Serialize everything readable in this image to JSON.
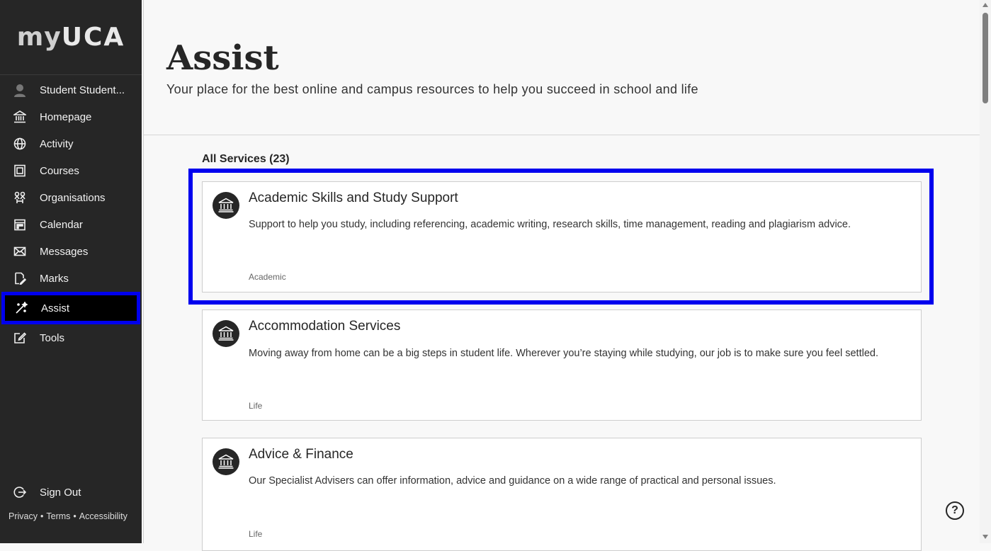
{
  "sidebar": {
    "logo": {
      "prefix": "my",
      "brand": "UCA"
    },
    "items": [
      {
        "label": "Student Student...",
        "icon": "user-avatar-icon"
      },
      {
        "label": "Homepage",
        "icon": "institution-icon"
      },
      {
        "label": "Activity",
        "icon": "globe-icon"
      },
      {
        "label": "Courses",
        "icon": "courses-icon"
      },
      {
        "label": "Organisations",
        "icon": "organisations-icon"
      },
      {
        "label": "Calendar",
        "icon": "calendar-icon"
      },
      {
        "label": "Messages",
        "icon": "envelope-icon"
      },
      {
        "label": "Marks",
        "icon": "marks-icon"
      },
      {
        "label": "Assist",
        "icon": "assist-icon"
      },
      {
        "label": "Tools",
        "icon": "tools-icon"
      }
    ],
    "sign_out": "Sign Out",
    "footer": {
      "privacy": "Privacy",
      "terms": "Terms",
      "accessibility": "Accessibility",
      "separator": "•"
    }
  },
  "main": {
    "title": "Assist",
    "subtitle": "Your place for the best online and campus resources to help you succeed in school and life",
    "services_heading": "All Services (23)",
    "services": [
      {
        "title": "Academic Skills and Study Support",
        "description": "Support to help you study, including referencing, academic writing, research skills, time management, reading and plagiarism advice.",
        "category": "Academic"
      },
      {
        "title": "Accommodation Services",
        "description": "Moving away from home can be a big steps in student life. Wherever you’re staying while studying, our job is to make sure you feel settled.",
        "category": "Life"
      },
      {
        "title": "Advice & Finance",
        "description": "Our Specialist Advisers can offer information, advice and guidance on a wide range of practical and personal issues.",
        "category": "Life"
      }
    ],
    "help_label": "?"
  },
  "colors": {
    "sidebar_bg": "#262626",
    "highlight": "#0000ee",
    "active_bg": "#000000"
  }
}
